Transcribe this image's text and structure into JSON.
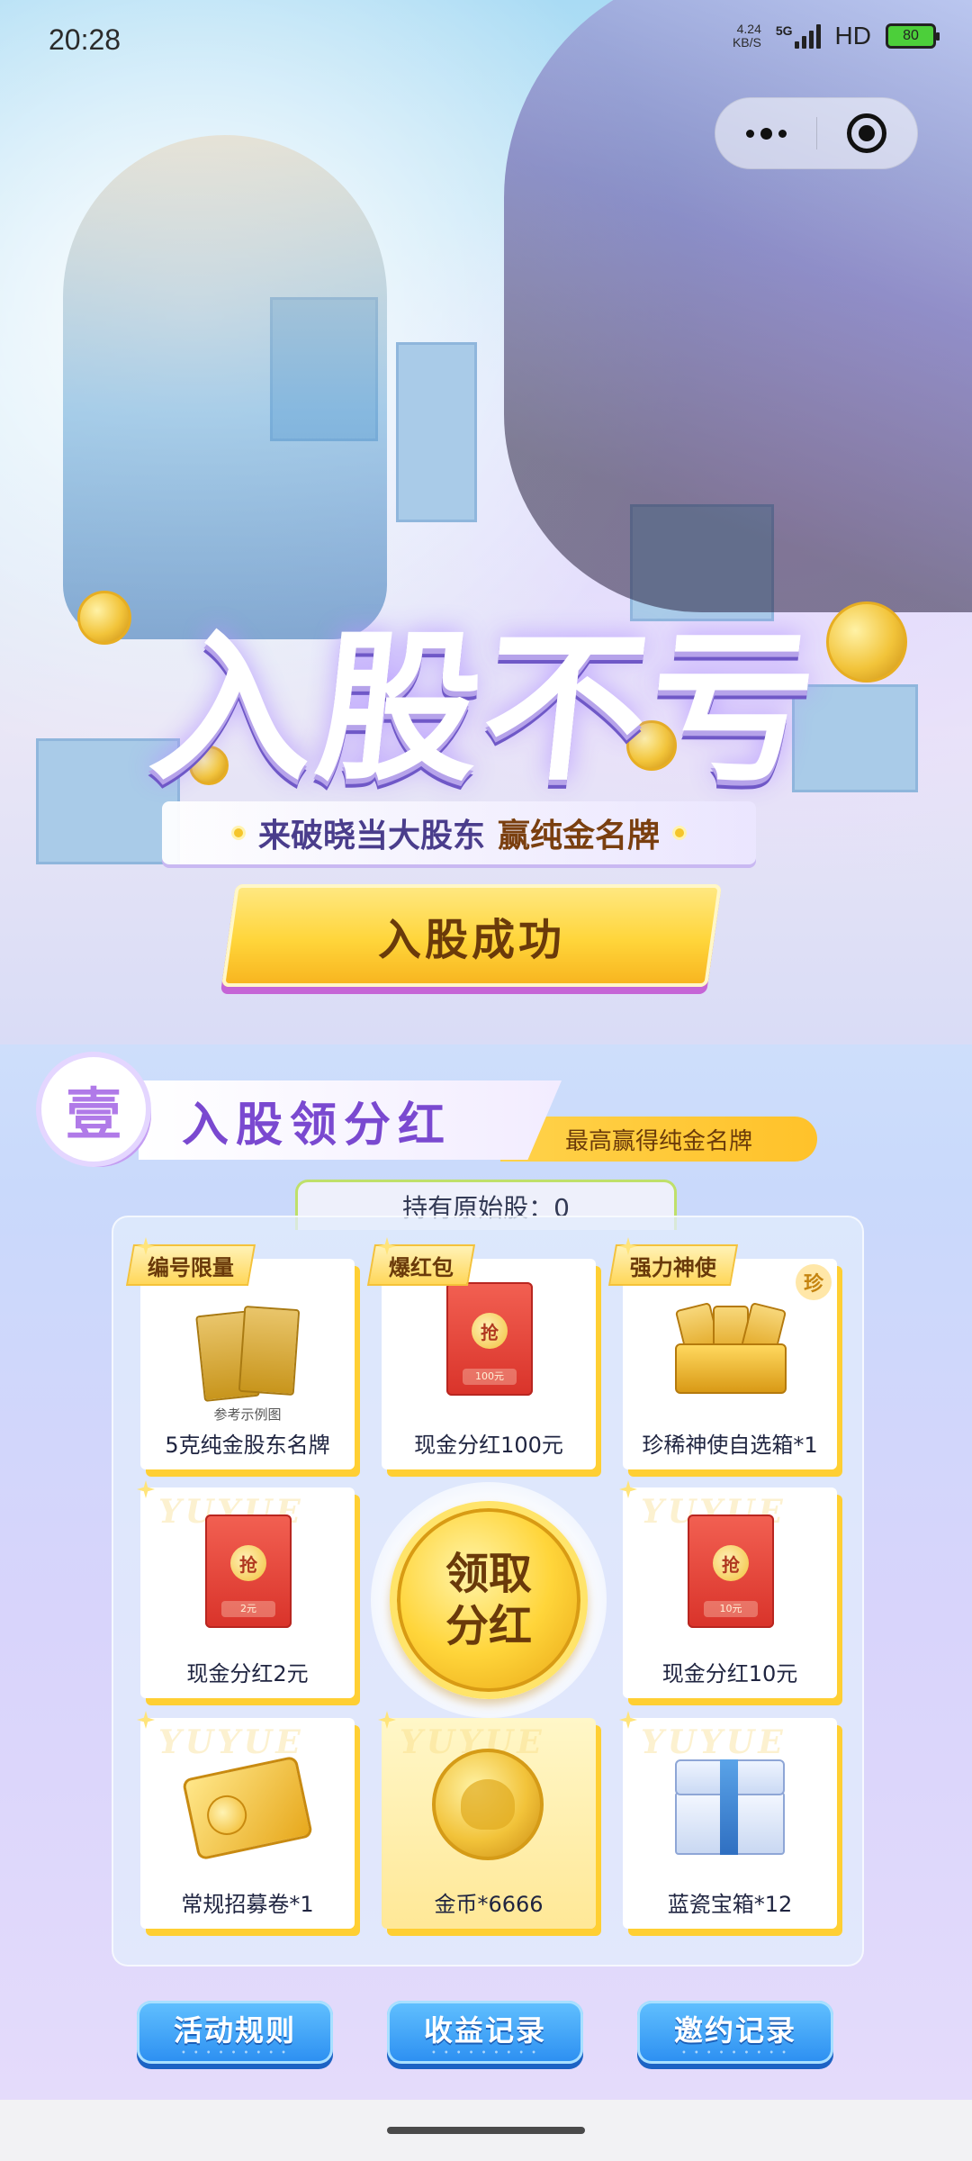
{
  "status_bar": {
    "time": "20:28",
    "net_speed_value": "4.24",
    "net_speed_unit": "KB/S",
    "network": "5G",
    "hd": "HD",
    "battery": "80"
  },
  "hero": {
    "title": "入股不亏",
    "subtitle": "来破晓当大股东",
    "subtitle_highlight": "赢纯金名牌",
    "cta_label": "入股成功"
  },
  "section": {
    "badge": "壹",
    "title": "入股领分红",
    "pill": "最高赢得纯金名牌",
    "shares_label": "持有原始股：0"
  },
  "rewards": [
    {
      "label": "5克纯金股东名牌",
      "tag": "编号限量",
      "note": "参考示例图",
      "icon": "gold-nameplate-icon"
    },
    {
      "label": "现金分红100元",
      "tag": "爆红包",
      "amount": "100元",
      "seal": "抢",
      "icon": "red-packet-icon"
    },
    {
      "label": "珍稀神使自选箱*1",
      "tag": "强力神使",
      "badge": "珍",
      "icon": "selection-chest-icon"
    },
    {
      "label": "现金分红2元",
      "amount": "2元",
      "seal": "抢",
      "icon": "red-packet-icon"
    },
    {
      "label": "现金分红10元",
      "amount": "10元",
      "seal": "抢",
      "icon": "red-packet-icon"
    },
    {
      "label": "常规招募卷*1",
      "icon": "recruit-ticket-icon"
    },
    {
      "label": "金币*6666",
      "icon": "gold-coin-icon"
    },
    {
      "label": "蓝瓷宝箱*12",
      "icon": "blue-porcelain-chest-icon"
    }
  ],
  "claim_button": {
    "line1": "领取",
    "line2": "分红"
  },
  "watermark": "YUYUE",
  "bottom_buttons": [
    {
      "label": "活动规则"
    },
    {
      "label": "收益记录"
    },
    {
      "label": "邀约记录"
    }
  ],
  "colors": {
    "accent_gold": "#ffd53a",
    "accent_purple": "#7a49d0",
    "button_blue": "#2b8ef1",
    "card_shadow": "#ffcf33"
  }
}
